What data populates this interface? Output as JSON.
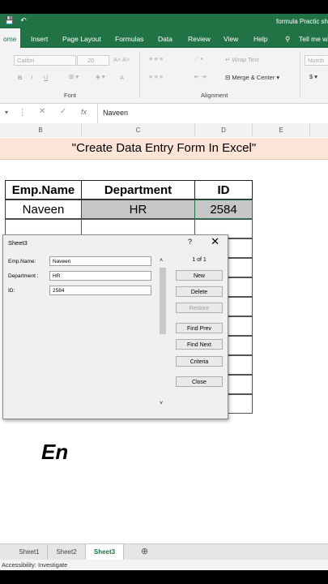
{
  "window": {
    "title": "formula Practic sh",
    "qat_icons": [
      "save-icon",
      "undo-icon"
    ]
  },
  "ribbon_tabs": [
    "ome",
    "Insert",
    "Page Layout",
    "Formulas",
    "Data",
    "Review",
    "View",
    "Help",
    "Tell me wh"
  ],
  "ribbon": {
    "font_name": "Calibri",
    "font_size": "20",
    "font_buttons": [
      "B",
      "I",
      "U",
      "A"
    ],
    "wrap_text": "Wrap Text",
    "merge_center": "Merge & Center",
    "number_format": "Numb",
    "currency": "$",
    "group_font": "Font",
    "group_alignment": "Alignment"
  },
  "formula_bar": {
    "fx": "fx",
    "value": "Naveen"
  },
  "columns": [
    "B",
    "C",
    "D",
    "E"
  ],
  "sheet": {
    "title": "\"Create Data Entry Form In Excel\"",
    "headers": [
      "Emp.Name",
      "Department",
      "ID"
    ],
    "row": [
      "Naveen",
      "HR",
      "2584"
    ]
  },
  "dialog": {
    "title": "Sheet3",
    "help": "?",
    "close": "✕",
    "counter": "1 of 1",
    "fields": [
      {
        "label": "Emp.Name:",
        "value": "Naveen"
      },
      {
        "label": "Department :",
        "value": "HR"
      },
      {
        "label": "ID:",
        "value": "2584"
      }
    ],
    "buttons": [
      {
        "label": "New",
        "enabled": true
      },
      {
        "label": "Delete",
        "enabled": true
      },
      {
        "label": "Restore",
        "enabled": false
      },
      {
        "label": "Find Prev",
        "enabled": true
      },
      {
        "label": "Find Next",
        "enabled": true
      },
      {
        "label": "Criteria",
        "enabled": true
      },
      {
        "label": "Close",
        "enabled": true
      }
    ]
  },
  "overlay_text": "En",
  "sheet_tabs": [
    "Sheet1",
    "Sheet2",
    "Sheet3"
  ],
  "add_sheet": "⊕",
  "status": "Accessibility: Investigate",
  "colors": {
    "excel_green": "#217346",
    "title_band": "#fce4d6",
    "selected_cell": "#c6c6c6"
  }
}
